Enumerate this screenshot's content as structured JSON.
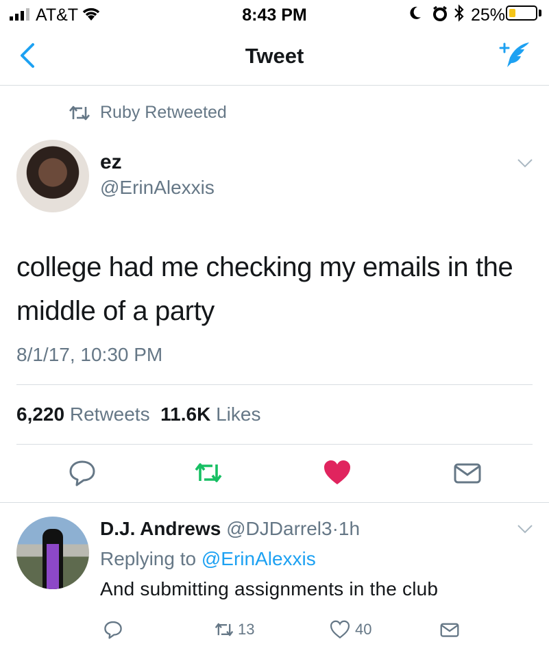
{
  "status_bar": {
    "carrier": "AT&T",
    "time": "8:43 PM",
    "battery_percent": "25%",
    "battery_level": 0.25
  },
  "nav": {
    "title": "Tweet"
  },
  "retweet_context": {
    "text": "Ruby Retweeted"
  },
  "tweet": {
    "display_name": "ez",
    "handle": "@ErinAlexxis",
    "text_line1": "college had me checking my emails in the",
    "text_line2": "middle of a party",
    "timestamp": "8/1/17, 10:30 PM",
    "retweet_count": "6,220",
    "retweets_label": "Retweets",
    "like_count": "11.6K",
    "likes_label": "Likes",
    "liked": true
  },
  "reply": {
    "display_name": "D.J. Andrews",
    "handle": "@DJDarrel3",
    "separator": "·",
    "age": "1h",
    "replying_prefix": "Replying to",
    "replying_to": "@ErinAlexxis",
    "text": "And submitting assignments in the club",
    "retweet_count": "13",
    "like_count": "40"
  },
  "colors": {
    "accent": "#1da1f2",
    "retweet_green": "#17bf63",
    "like_red": "#e0245e",
    "secondary_text": "#657786",
    "divider": "#d8dde1"
  },
  "icons": [
    "signal-icon",
    "wifi-icon",
    "moon-icon",
    "alarm-icon",
    "bluetooth-icon",
    "battery-icon",
    "back-chevron-icon",
    "compose-tweet-icon",
    "retweet-icon",
    "chevron-down-icon",
    "reply-icon",
    "like-icon",
    "direct-message-icon"
  ]
}
